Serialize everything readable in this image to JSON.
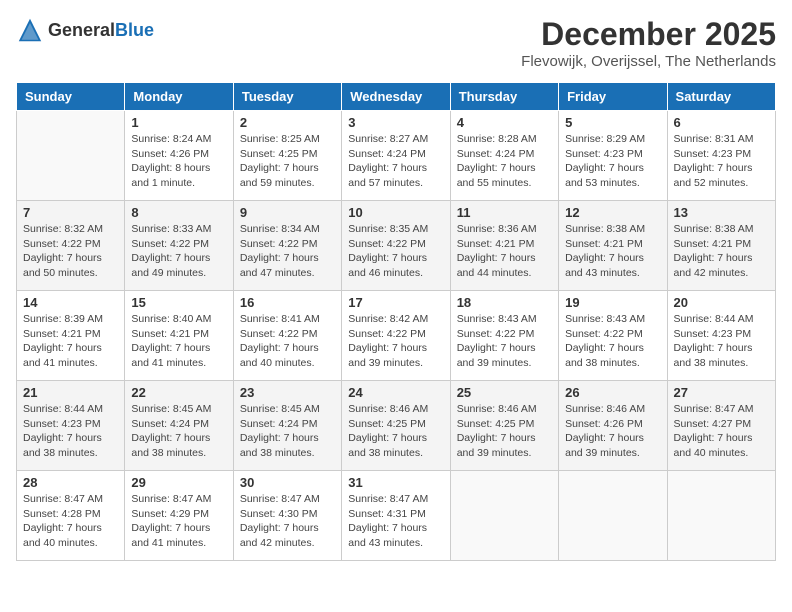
{
  "header": {
    "logo_general": "General",
    "logo_blue": "Blue",
    "title": "December 2025",
    "subtitle": "Flevowijk, Overijssel, The Netherlands"
  },
  "weekdays": [
    "Sunday",
    "Monday",
    "Tuesday",
    "Wednesday",
    "Thursday",
    "Friday",
    "Saturday"
  ],
  "weeks": [
    [
      {
        "day": "",
        "detail": ""
      },
      {
        "day": "1",
        "detail": "Sunrise: 8:24 AM\nSunset: 4:26 PM\nDaylight: 8 hours\nand 1 minute."
      },
      {
        "day": "2",
        "detail": "Sunrise: 8:25 AM\nSunset: 4:25 PM\nDaylight: 7 hours\nand 59 minutes."
      },
      {
        "day": "3",
        "detail": "Sunrise: 8:27 AM\nSunset: 4:24 PM\nDaylight: 7 hours\nand 57 minutes."
      },
      {
        "day": "4",
        "detail": "Sunrise: 8:28 AM\nSunset: 4:24 PM\nDaylight: 7 hours\nand 55 minutes."
      },
      {
        "day": "5",
        "detail": "Sunrise: 8:29 AM\nSunset: 4:23 PM\nDaylight: 7 hours\nand 53 minutes."
      },
      {
        "day": "6",
        "detail": "Sunrise: 8:31 AM\nSunset: 4:23 PM\nDaylight: 7 hours\nand 52 minutes."
      }
    ],
    [
      {
        "day": "7",
        "detail": "Sunrise: 8:32 AM\nSunset: 4:22 PM\nDaylight: 7 hours\nand 50 minutes."
      },
      {
        "day": "8",
        "detail": "Sunrise: 8:33 AM\nSunset: 4:22 PM\nDaylight: 7 hours\nand 49 minutes."
      },
      {
        "day": "9",
        "detail": "Sunrise: 8:34 AM\nSunset: 4:22 PM\nDaylight: 7 hours\nand 47 minutes."
      },
      {
        "day": "10",
        "detail": "Sunrise: 8:35 AM\nSunset: 4:22 PM\nDaylight: 7 hours\nand 46 minutes."
      },
      {
        "day": "11",
        "detail": "Sunrise: 8:36 AM\nSunset: 4:21 PM\nDaylight: 7 hours\nand 44 minutes."
      },
      {
        "day": "12",
        "detail": "Sunrise: 8:38 AM\nSunset: 4:21 PM\nDaylight: 7 hours\nand 43 minutes."
      },
      {
        "day": "13",
        "detail": "Sunrise: 8:38 AM\nSunset: 4:21 PM\nDaylight: 7 hours\nand 42 minutes."
      }
    ],
    [
      {
        "day": "14",
        "detail": "Sunrise: 8:39 AM\nSunset: 4:21 PM\nDaylight: 7 hours\nand 41 minutes."
      },
      {
        "day": "15",
        "detail": "Sunrise: 8:40 AM\nSunset: 4:21 PM\nDaylight: 7 hours\nand 41 minutes."
      },
      {
        "day": "16",
        "detail": "Sunrise: 8:41 AM\nSunset: 4:22 PM\nDaylight: 7 hours\nand 40 minutes."
      },
      {
        "day": "17",
        "detail": "Sunrise: 8:42 AM\nSunset: 4:22 PM\nDaylight: 7 hours\nand 39 minutes."
      },
      {
        "day": "18",
        "detail": "Sunrise: 8:43 AM\nSunset: 4:22 PM\nDaylight: 7 hours\nand 39 minutes."
      },
      {
        "day": "19",
        "detail": "Sunrise: 8:43 AM\nSunset: 4:22 PM\nDaylight: 7 hours\nand 38 minutes."
      },
      {
        "day": "20",
        "detail": "Sunrise: 8:44 AM\nSunset: 4:23 PM\nDaylight: 7 hours\nand 38 minutes."
      }
    ],
    [
      {
        "day": "21",
        "detail": "Sunrise: 8:44 AM\nSunset: 4:23 PM\nDaylight: 7 hours\nand 38 minutes."
      },
      {
        "day": "22",
        "detail": "Sunrise: 8:45 AM\nSunset: 4:24 PM\nDaylight: 7 hours\nand 38 minutes."
      },
      {
        "day": "23",
        "detail": "Sunrise: 8:45 AM\nSunset: 4:24 PM\nDaylight: 7 hours\nand 38 minutes."
      },
      {
        "day": "24",
        "detail": "Sunrise: 8:46 AM\nSunset: 4:25 PM\nDaylight: 7 hours\nand 38 minutes."
      },
      {
        "day": "25",
        "detail": "Sunrise: 8:46 AM\nSunset: 4:25 PM\nDaylight: 7 hours\nand 39 minutes."
      },
      {
        "day": "26",
        "detail": "Sunrise: 8:46 AM\nSunset: 4:26 PM\nDaylight: 7 hours\nand 39 minutes."
      },
      {
        "day": "27",
        "detail": "Sunrise: 8:47 AM\nSunset: 4:27 PM\nDaylight: 7 hours\nand 40 minutes."
      }
    ],
    [
      {
        "day": "28",
        "detail": "Sunrise: 8:47 AM\nSunset: 4:28 PM\nDaylight: 7 hours\nand 40 minutes."
      },
      {
        "day": "29",
        "detail": "Sunrise: 8:47 AM\nSunset: 4:29 PM\nDaylight: 7 hours\nand 41 minutes."
      },
      {
        "day": "30",
        "detail": "Sunrise: 8:47 AM\nSunset: 4:30 PM\nDaylight: 7 hours\nand 42 minutes."
      },
      {
        "day": "31",
        "detail": "Sunrise: 8:47 AM\nSunset: 4:31 PM\nDaylight: 7 hours\nand 43 minutes."
      },
      {
        "day": "",
        "detail": ""
      },
      {
        "day": "",
        "detail": ""
      },
      {
        "day": "",
        "detail": ""
      }
    ]
  ]
}
